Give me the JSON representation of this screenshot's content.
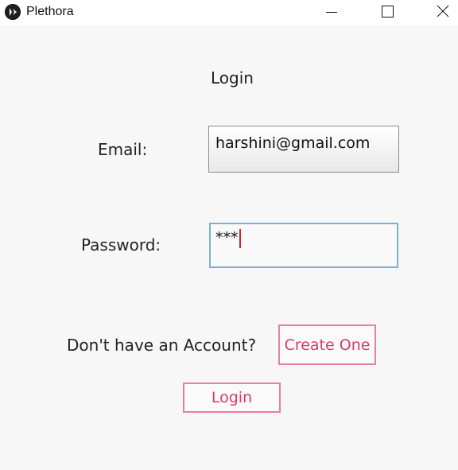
{
  "window": {
    "title": "Plethora",
    "icon": "kivy-logo-icon",
    "controls": [
      "minimize-icon",
      "maximize-icon",
      "close-icon"
    ]
  },
  "form": {
    "heading": "Login",
    "email_label": "Email:",
    "email_value": "harshini@gmail.com",
    "password_label": "Password:",
    "password_value": "***",
    "signup_prompt": "Don't have an Account?",
    "create_button": "Create One",
    "login_button": "Login"
  },
  "colors": {
    "accent": "#e87ea0",
    "accent_text": "#d93a6f",
    "focus_border": "#7fb0cc",
    "caret": "#d2232a"
  }
}
